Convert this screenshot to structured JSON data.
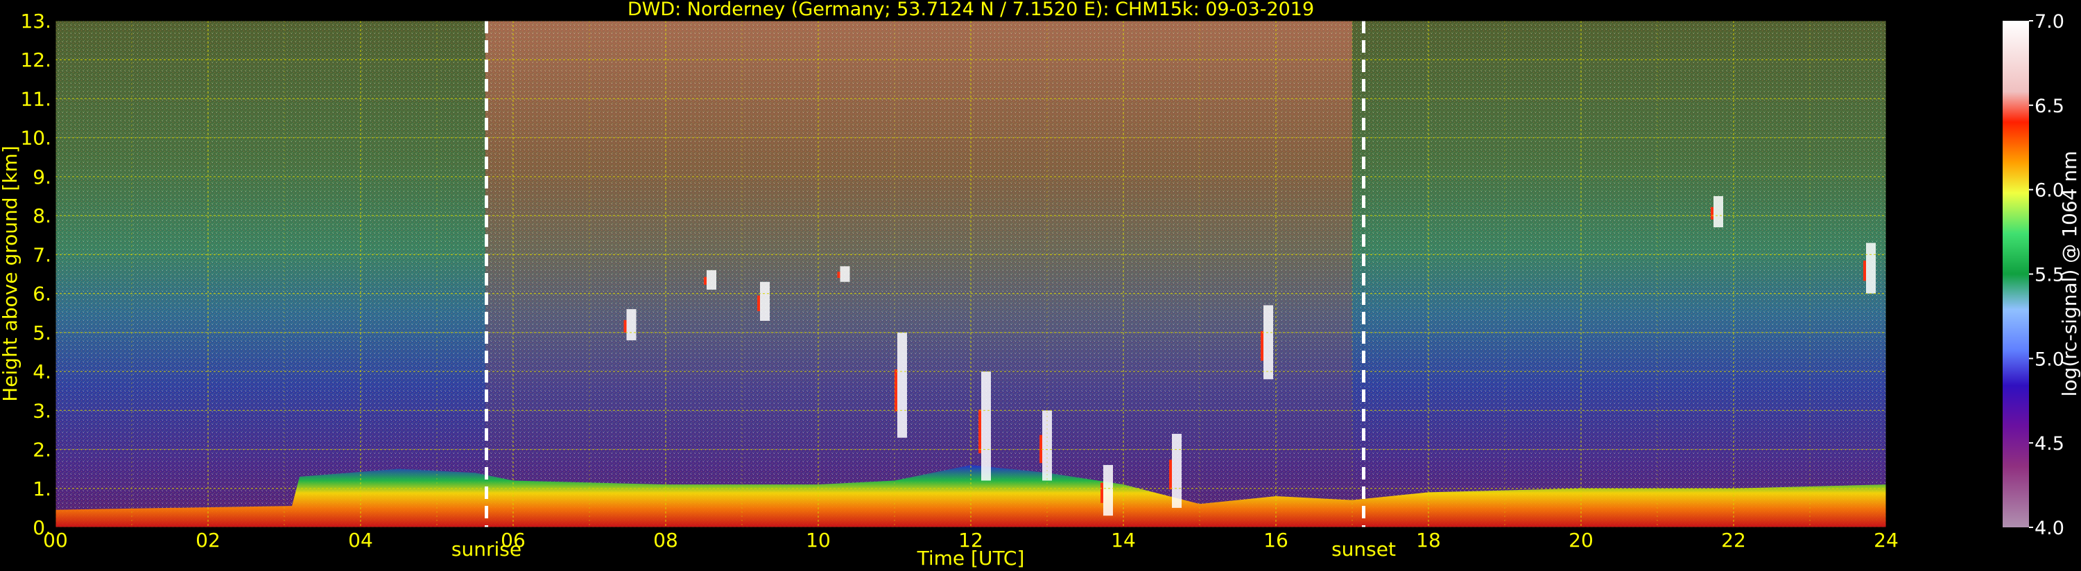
{
  "chart_data": {
    "type": "heatmap",
    "title": "DWD: Norderney (Germany; 53.7124 N / 7.1520 E):    CHM15k: 09-03-2019",
    "xlabel": "Time [UTC]",
    "ylabel": "Height above ground [km]",
    "xlim": [
      0,
      24
    ],
    "ylim": [
      0,
      13
    ],
    "x_ticks": [
      "00",
      "02",
      "04",
      "06",
      "08",
      "10",
      "12",
      "14",
      "16",
      "18",
      "20",
      "22",
      "24"
    ],
    "y_ticks": [
      "0.",
      "1.",
      "2.",
      "3.",
      "4.",
      "5.",
      "6.",
      "7.",
      "8.",
      "9.",
      "10.",
      "11.",
      "12.",
      "13."
    ],
    "grid": true,
    "annotations": [
      {
        "label": "sunrise",
        "x": 5.65
      },
      {
        "label": "sunset",
        "x": 17.15
      }
    ],
    "colorbar": {
      "label": "log(rc-signal) @ 1064 nm",
      "range": [
        4.0,
        7.0
      ],
      "ticks": [
        "4.0",
        "4.5",
        "5.0",
        "5.5",
        "6.0",
        "6.5",
        "7.0"
      ]
    },
    "boundary_layer_top_km": [
      [
        0,
        0.45
      ],
      [
        3.1,
        0.55
      ],
      [
        3.2,
        1.3
      ],
      [
        4.5,
        1.5
      ],
      [
        5.5,
        1.4
      ],
      [
        6,
        1.2
      ],
      [
        8,
        1.1
      ],
      [
        10,
        1.1
      ],
      [
        11,
        1.2
      ],
      [
        12,
        1.6
      ],
      [
        13,
        1.4
      ],
      [
        14,
        1.1
      ],
      [
        15,
        0.6
      ],
      [
        16,
        0.8
      ],
      [
        17,
        0.7
      ],
      [
        18,
        0.9
      ],
      [
        20,
        1.0
      ],
      [
        22,
        1.0
      ],
      [
        24,
        1.1
      ]
    ],
    "cloud_features": [
      {
        "x": 7.55,
        "y_bottom": 4.8,
        "y_top": 5.6
      },
      {
        "x": 8.6,
        "y_bottom": 6.1,
        "y_top": 6.6
      },
      {
        "x": 9.3,
        "y_bottom": 5.3,
        "y_top": 6.3
      },
      {
        "x": 10.35,
        "y_bottom": 6.3,
        "y_top": 6.7
      },
      {
        "x": 11.1,
        "y_bottom": 2.3,
        "y_top": 5.0
      },
      {
        "x": 12.2,
        "y_bottom": 1.2,
        "y_top": 4.0
      },
      {
        "x": 13.0,
        "y_bottom": 1.2,
        "y_top": 3.0
      },
      {
        "x": 13.8,
        "y_bottom": 0.3,
        "y_top": 1.6
      },
      {
        "x": 14.7,
        "y_bottom": 0.5,
        "y_top": 2.4
      },
      {
        "x": 15.9,
        "y_bottom": 3.8,
        "y_top": 5.7
      },
      {
        "x": 21.8,
        "y_bottom": 7.7,
        "y_top": 8.5
      },
      {
        "x": 23.8,
        "y_bottom": 6.0,
        "y_top": 7.3
      }
    ]
  },
  "colors": {
    "axis_text": "#ffff00",
    "grid": "#d8d800",
    "annotation_line": "#ffffff",
    "colorbar_text": "#ffffff",
    "background": "#000000"
  }
}
